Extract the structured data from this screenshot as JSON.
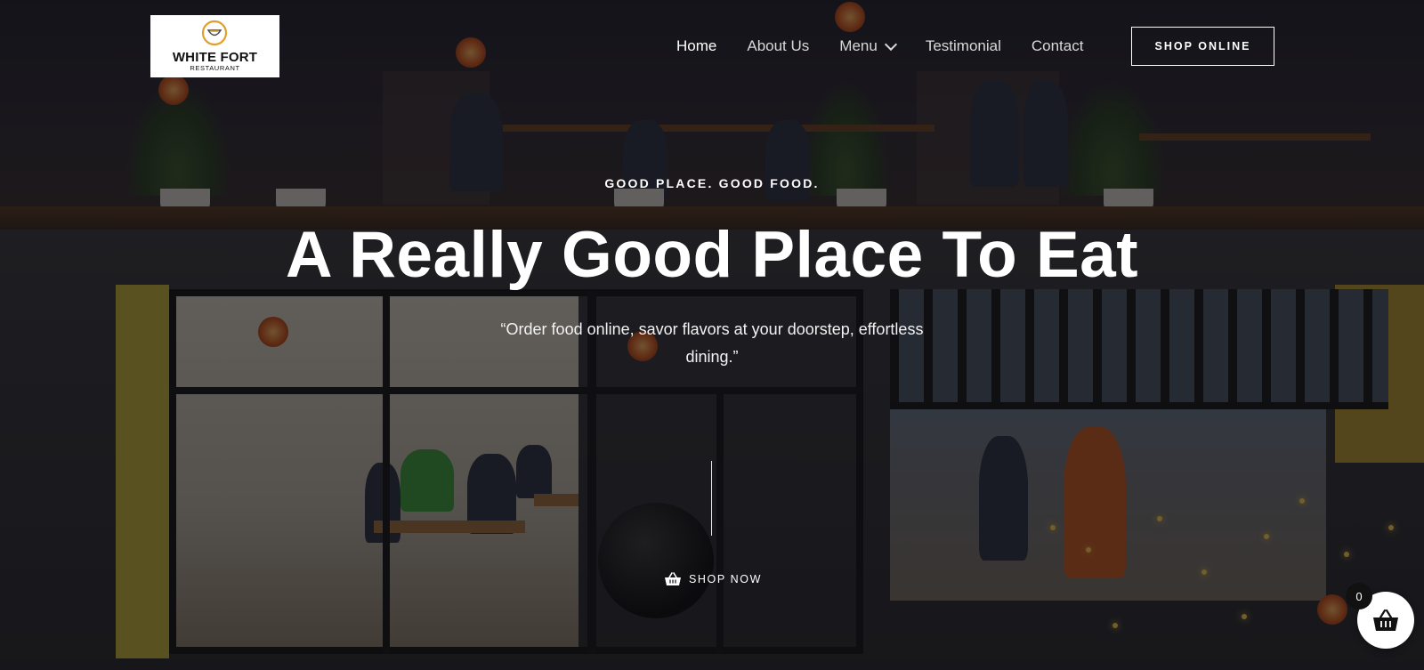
{
  "brand": {
    "name": "WHITE FORT",
    "subtitle": "RESTAURANT"
  },
  "nav": {
    "items": [
      {
        "label": "Home",
        "active": true
      },
      {
        "label": "About Us",
        "active": false
      },
      {
        "label": "Menu",
        "active": false,
        "has_dropdown": true
      },
      {
        "label": "Testimonial",
        "active": false
      },
      {
        "label": "Contact",
        "active": false
      }
    ],
    "cta_label": "SHOP ONLINE"
  },
  "hero": {
    "tagline": "GOOD PLACE. GOOD FOOD.",
    "title": "A Really Good Place To Eat",
    "quote": "“Order food online, savor flavors at your doorstep, effortless dining.”",
    "shop_now_label": "SHOP NOW",
    "shop_now_icon": "basket-icon"
  },
  "cart": {
    "count": "0",
    "icon": "basket-icon"
  },
  "colors": {
    "overlay": "#0a0a10",
    "text": "#ffffff",
    "nav_inactive": "#d8d8d8",
    "logo_bg": "#ffffff",
    "logo_accent": "#e0a030"
  }
}
